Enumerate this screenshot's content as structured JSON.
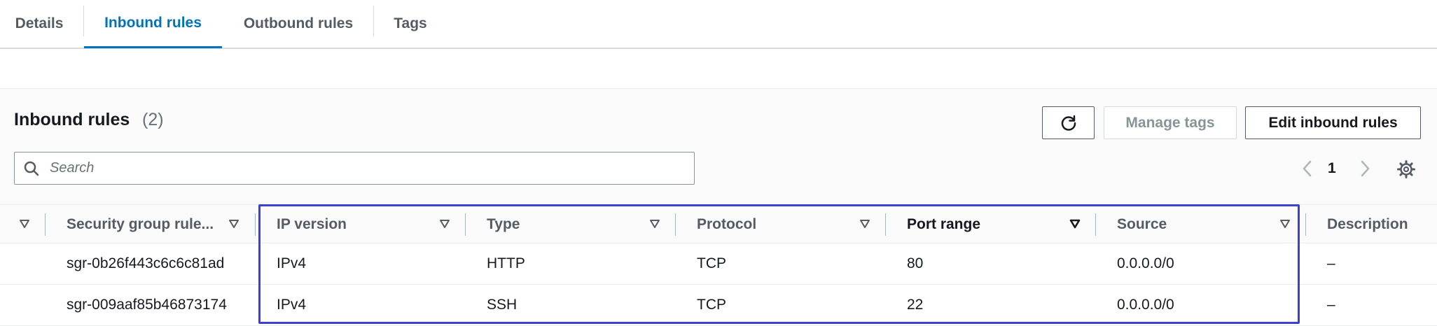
{
  "tabs": [
    {
      "label": "Details",
      "active": false
    },
    {
      "label": "Inbound rules",
      "active": true
    },
    {
      "label": "Outbound rules",
      "active": false
    },
    {
      "label": "Tags",
      "active": false
    }
  ],
  "panel": {
    "title": "Inbound rules",
    "count": "(2)",
    "manage_tags_label": "Manage tags",
    "edit_label": "Edit inbound rules",
    "refresh_icon": "refresh-icon",
    "search": {
      "placeholder": "Search",
      "value": ""
    },
    "pagination": {
      "current_page": "1"
    }
  },
  "table": {
    "columns": [
      "Security group rule...",
      "IP version",
      "Type",
      "Protocol",
      "Port range",
      "Source",
      "Description"
    ],
    "sorted_column": "Port range",
    "rows": [
      {
        "rule_id": "sgr-0b26f443c6c6c81ad",
        "ip_version": "IPv4",
        "type": "HTTP",
        "protocol": "TCP",
        "port_range": "80",
        "source": "0.0.0.0/0",
        "description": "–"
      },
      {
        "rule_id": "sgr-009aaf85b46873174",
        "ip_version": "IPv4",
        "type": "SSH",
        "protocol": "TCP",
        "port_range": "22",
        "source": "0.0.0.0/0",
        "description": "–"
      }
    ]
  },
  "colors": {
    "accent": "#0073bb",
    "highlight": "#3f3fd1",
    "header_bg": "#fafafa"
  }
}
